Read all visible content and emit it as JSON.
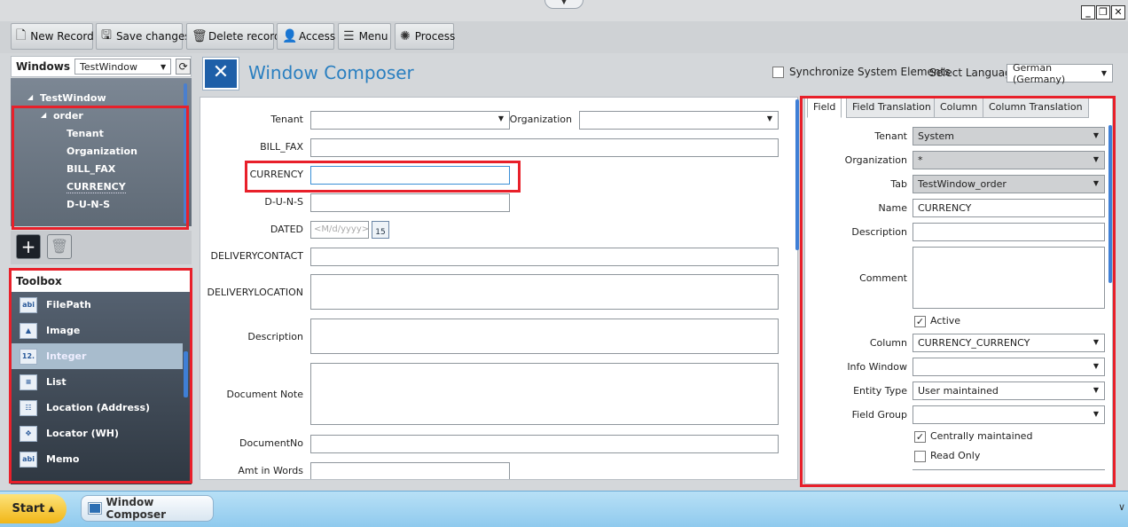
{
  "toolbar": {
    "buttons": [
      {
        "label": "New Record",
        "icon": "new-record-icon"
      },
      {
        "label": "Save changes",
        "icon": "save-icon"
      },
      {
        "label": "Delete record",
        "icon": "trash-icon"
      },
      {
        "label": "Access",
        "icon": "users-icon"
      },
      {
        "label": "Menu",
        "icon": "menu-icon"
      },
      {
        "label": "Process",
        "icon": "process-icon"
      }
    ]
  },
  "windows_selector": {
    "label": "Windows",
    "value": "TestWindow"
  },
  "tree": {
    "root": "TestWindow",
    "tab": "order",
    "fields": [
      "Tenant",
      "Organization",
      "BILL_FAX",
      "CURRENCY",
      "D-U-N-S"
    ]
  },
  "toolbox": {
    "title": "Toolbox",
    "items": [
      {
        "label": "FilePath",
        "icon": "text-field-icon"
      },
      {
        "label": "Image",
        "icon": "image-icon"
      },
      {
        "label": "Integer",
        "icon": "integer-icon"
      },
      {
        "label": "List",
        "icon": "list-icon"
      },
      {
        "label": "Location (Address)",
        "icon": "location-icon"
      },
      {
        "label": "Locator (WH)",
        "icon": "locator-icon"
      },
      {
        "label": "Memo",
        "icon": "text-field-icon"
      }
    ],
    "selected": "Integer"
  },
  "header": {
    "title": "Window Composer",
    "sync_label": "Synchronize System Elements",
    "sync_checked": false,
    "language_label": "Select Language",
    "language_value": "German (Germany)"
  },
  "form": {
    "tenant_label": "Tenant",
    "organization_label": "Organization",
    "bill_fax_label": "BILL_FAX",
    "currency_label": "CURRENCY",
    "duns_label": "D-U-N-S",
    "dated_label": "DATED",
    "dated_placeholder": "<M/d/yyyy>",
    "calendar_day": "15",
    "delivery_contact_label": "DELIVERYCONTACT",
    "delivery_location_label": "DELIVERYLOCATION",
    "description_label": "Description",
    "document_note_label": "Document Note",
    "document_no_label": "DocumentNo",
    "amt_in_words_label": "Amt in Words"
  },
  "properties": {
    "tabs": [
      "Field",
      "Field Translation",
      "Column",
      "Column Translation"
    ],
    "active_tab": "Field",
    "tenant_label": "Tenant",
    "tenant_value": "System",
    "organization_label": "Organization",
    "organization_value": "*",
    "tab_label": "Tab",
    "tab_value": "TestWindow_order",
    "name_label": "Name",
    "name_value": "CURRENCY",
    "description_label": "Description",
    "description_value": "",
    "comment_label": "Comment",
    "comment_value": "",
    "active_label": "Active",
    "active_checked": true,
    "column_label": "Column",
    "column_value": "CURRENCY_CURRENCY",
    "info_window_label": "Info Window",
    "info_window_value": "",
    "entity_type_label": "Entity Type",
    "entity_type_value": "User maintained",
    "field_group_label": "Field Group",
    "field_group_value": "",
    "centrally_label": "Centrally maintained",
    "centrally_checked": true,
    "read_only_label": "Read Only",
    "read_only_checked": false
  },
  "taskbar": {
    "start_label": "Start",
    "task_label": "Window Composer"
  },
  "colors": {
    "accent": "#2a7fc0",
    "highlight_box": "#e8202a",
    "tree_bg": "#6f7a86",
    "toolbox_bg": "#3d4753",
    "taskbar": "#a6d6f2",
    "start": "#f6c93a"
  }
}
